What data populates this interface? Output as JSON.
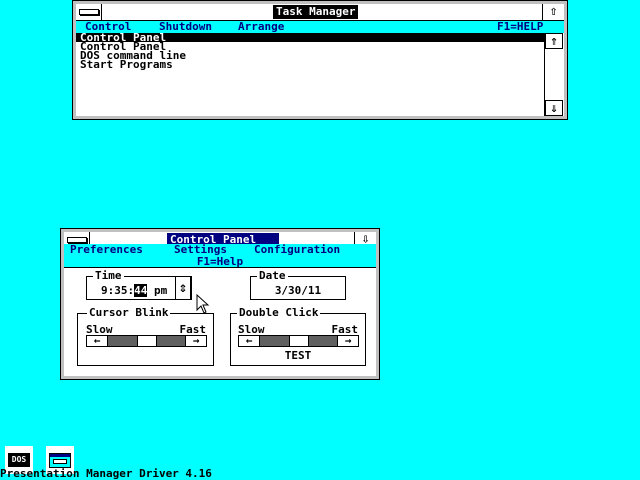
{
  "task_manager": {
    "title": "Task Manager",
    "restore_glyph": "⇧",
    "menu": {
      "control": "Control",
      "shutdown": "Shutdown",
      "arrange": "Arrange",
      "help": "F1=HELP"
    },
    "items": [
      "Control Panel",
      "Control Panel",
      "DOS command line",
      "Start Programs"
    ],
    "scroll_up_glyph": "⇑",
    "scroll_down_glyph": "⇓"
  },
  "control_panel": {
    "title": "Control Panel",
    "minimize_glyph": "⇩",
    "menu": {
      "preferences": "Preferences",
      "settings": "Settings",
      "configuration": "Configuration"
    },
    "help": "F1=Help",
    "time": {
      "label": "Time",
      "hour_min": "9:35:",
      "seconds": "44",
      "ampm": "pm",
      "spin_glyph": "⇕"
    },
    "date": {
      "label": "Date",
      "value": "3/30/11"
    },
    "cursor_blink": {
      "label": "Cursor Blink",
      "slow": "Slow",
      "fast": "Fast",
      "left_glyph": "←",
      "right_glyph": "→",
      "level": 0.5
    },
    "double_click": {
      "label": "Double Click",
      "slow": "Slow",
      "fast": "Fast",
      "left_glyph": "←",
      "right_glyph": "→",
      "level": 0.5,
      "test_label": "TEST"
    }
  },
  "desktop": {
    "dos_icon_label": "DOS",
    "status_text": "Presentation Manager Driver 4.16"
  },
  "colors": {
    "desktop": "#00ffff",
    "title_active": "#000080",
    "menu_text": "#000080"
  }
}
